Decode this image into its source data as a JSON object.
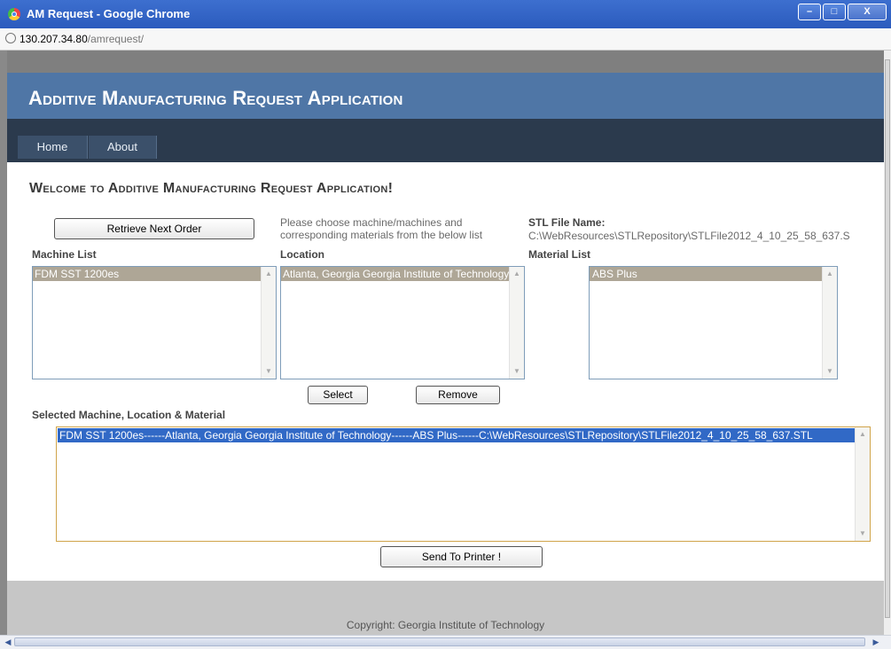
{
  "window": {
    "title": "AM Request - Google Chrome",
    "minimize": "–",
    "maximize": "□",
    "close": "X"
  },
  "address": {
    "host": "130.207.34.80",
    "path": "/amrequest/"
  },
  "header": {
    "title": "Additive Manufacturing Request Application"
  },
  "menu": {
    "home": "Home",
    "about": "About"
  },
  "main": {
    "welcome": "Welcome to Additive Manufacturing Request Application!",
    "retrieve_button": "Retrieve Next Order",
    "instructions": "Please choose machine/machines and corresponding materials from the below list",
    "stl_label": "STL File Name:",
    "stl_value": "C:\\WebResources\\STLRepository\\STLFile2012_4_10_25_58_637.S",
    "machine_label": "Machine List",
    "location_label": "Location",
    "material_label": "Material List",
    "machine_list": [
      "FDM SST 1200es"
    ],
    "location_list": [
      "Atlanta, Georgia Georgia Institute of Technology"
    ],
    "material_list": [
      "ABS Plus"
    ],
    "select_button": "Select",
    "remove_button": "Remove",
    "selected_label": "Selected Machine, Location & Material",
    "selected_list": [
      "FDM SST 1200es------Atlanta, Georgia Georgia Institute of Technology------ABS Plus------C:\\WebResources\\STLRepository\\STLFile2012_4_10_25_58_637.STL"
    ],
    "send_button": "Send To Printer !"
  },
  "footer": {
    "copyright": "Copyright: Georgia Institute of Technology"
  },
  "icons": {
    "app": "chrome-icon",
    "page": "page-globe-icon",
    "scroll_up": "▲",
    "scroll_down": "▼",
    "scroll_left": "◀",
    "scroll_right": "▶"
  },
  "colors": {
    "header_bg": "#4f76a6",
    "menu_bg": "#2b3a4d",
    "selected_gray": "#aea696",
    "selected_blue": "#3169c6",
    "titlebar": "#2b5bbd"
  }
}
